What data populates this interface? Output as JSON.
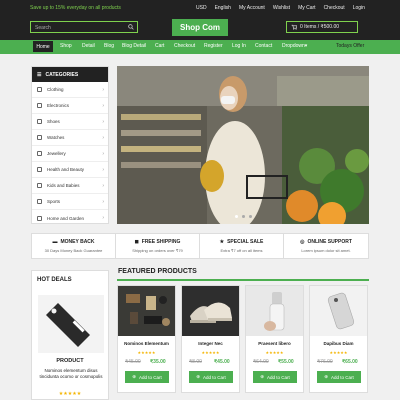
{
  "topbar": {
    "promo": "Save up to 15% everyday on all products",
    "links": [
      "USD",
      "English",
      "My Account",
      "Wishlist",
      "My Cart",
      "Checkout",
      "Login"
    ]
  },
  "header": {
    "logo": "Shop Com",
    "search_placeholder": "Search",
    "cart_label": "0 Items / ₹500.00"
  },
  "nav": {
    "items": [
      "Home",
      "Shop",
      "Detail",
      "Blog",
      "Blog Detail",
      "Cart",
      "Checkout",
      "Register",
      "Log In",
      "Contact",
      "Dropdown"
    ],
    "offer": "Todays Offer"
  },
  "categories": {
    "title": "CATEGORIES",
    "items": [
      "Clothing",
      "Electronics",
      "Shoes",
      "Watches",
      "Jewellery",
      "Health and Beauty",
      "Kids and Babies",
      "Sports",
      "Home and Garden"
    ]
  },
  "features": [
    {
      "title": "MONEY BACK",
      "sub": "30 Days Money Back Guarantee"
    },
    {
      "title": "FREE SHIPPING",
      "sub": "Shipping on orders over ₹79"
    },
    {
      "title": "SPECIAL SALE",
      "sub": "Extra ₹7 off on all items"
    },
    {
      "title": "ONLINE SUPPORT",
      "sub": "Lorem ipsum dolor sit amet."
    }
  ],
  "hotdeals": {
    "title": "HOT DEALS",
    "product": "PRODUCT",
    "desc": "Nominos elementum disus tincidunta ocomo or cosmopolis",
    "stars": "★★★★★"
  },
  "featured": {
    "title": "FEATURED PRODUCTS",
    "button": "Add to Cart",
    "products": [
      {
        "name": "Nominos Elementum",
        "old": "₹45.00",
        "price": "₹35.00",
        "stars": "★★★★★"
      },
      {
        "name": "Integer Nec",
        "old": "₹8.00",
        "price": "₹45.00",
        "stars": "★★★★★"
      },
      {
        "name": "Praesent libero",
        "old": "₹64.00",
        "price": "₹55.00",
        "stars": "★★★★★"
      },
      {
        "name": "Dapibus Diam",
        "old": "₹76.00",
        "price": "₹65.00",
        "stars": "★★★★★"
      }
    ]
  }
}
